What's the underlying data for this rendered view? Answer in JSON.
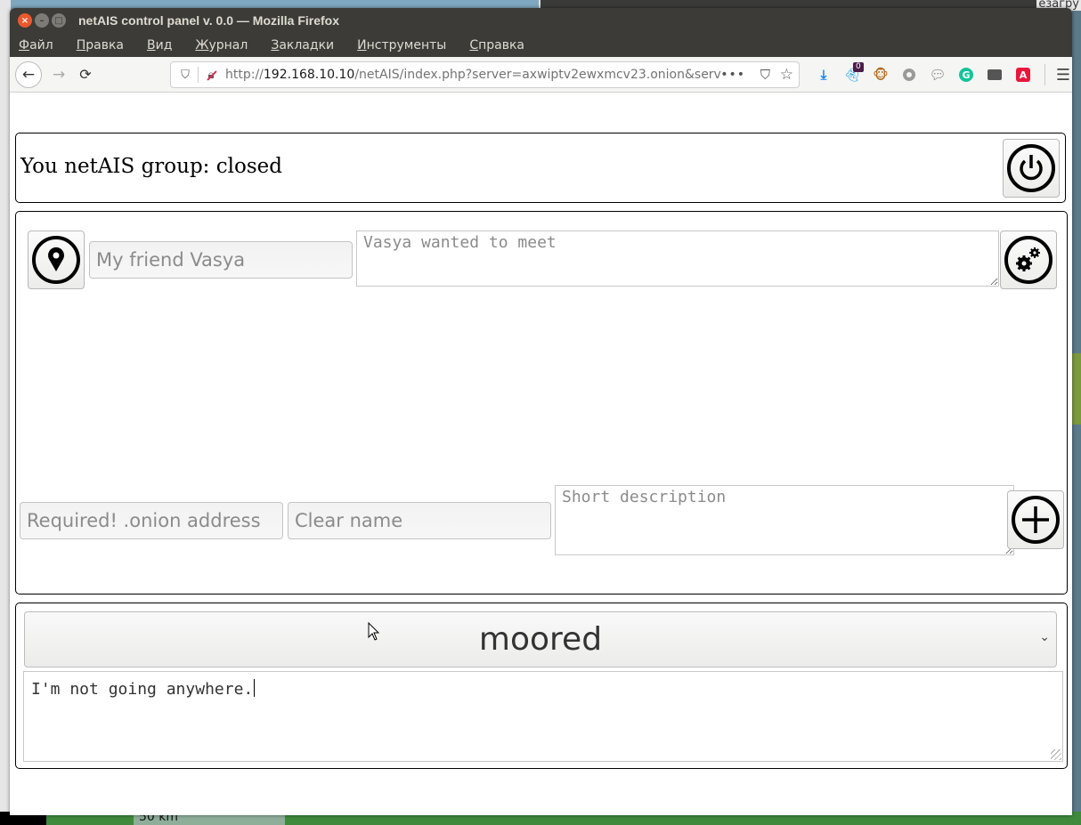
{
  "window": {
    "title": "netAIS control panel v. 0.0 — Mozilla Firefox"
  },
  "menubar": {
    "items": [
      {
        "first": "Ф",
        "rest": "айл"
      },
      {
        "first": "П",
        "rest": "равка"
      },
      {
        "first": "В",
        "rest": "ид"
      },
      {
        "first": "Ж",
        "rest": "урнал"
      },
      {
        "first": "З",
        "rest": "акладки"
      },
      {
        "first": "И",
        "rest": "нструменты"
      },
      {
        "first": "С",
        "rest": "правка"
      }
    ]
  },
  "navbar": {
    "url_prefix": "http://",
    "url_host": "192.168.10.10",
    "url_rest": "/netAIS/index.php?server=axwiptv2ewxmcv23.onion&serv",
    "toolbar_badge": "0"
  },
  "group": {
    "label": "You netAIS group: closed"
  },
  "friend_edit": {
    "name_placeholder": "My friend Vasya",
    "note_placeholder": "Vasya wanted to meet"
  },
  "friend_add": {
    "onion_placeholder": "Required! .onion address",
    "clearname_placeholder": "Clear name",
    "description_placeholder": "Short description"
  },
  "status": {
    "selected": "moored",
    "message": "I'm not going anywhere."
  },
  "background": {
    "top_right_text": "езагру",
    "map_scale": "50 km"
  }
}
